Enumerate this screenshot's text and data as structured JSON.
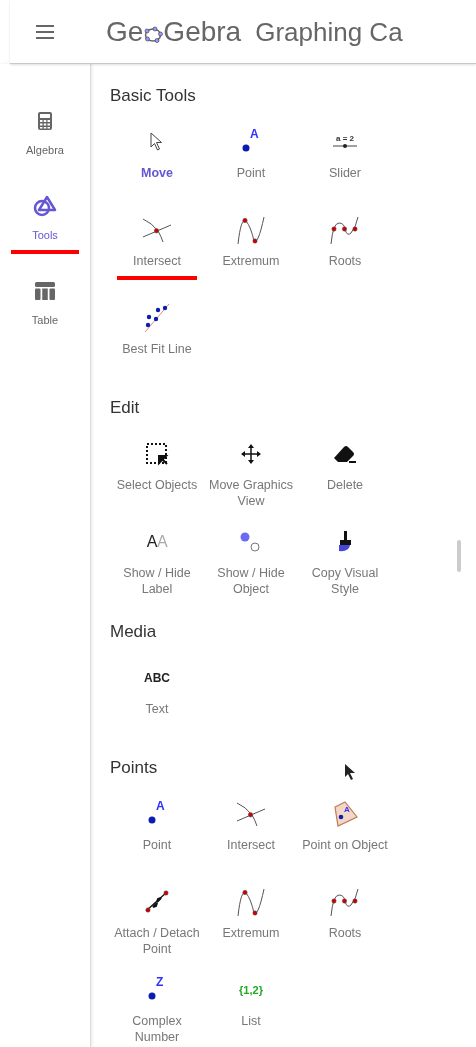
{
  "header": {
    "logo_before": "Ge",
    "logo_after": "Gebra",
    "title": "Graphing Ca"
  },
  "sidebar": {
    "items": [
      {
        "kind": "algebra",
        "label": "Algebra",
        "selected": false,
        "underlined": false
      },
      {
        "kind": "tools",
        "label": "Tools",
        "selected": true,
        "underlined": true
      },
      {
        "kind": "table",
        "label": "Table",
        "selected": false,
        "underlined": false
      }
    ]
  },
  "sections": [
    {
      "title": "Basic Tools",
      "tools": [
        {
          "kind": "move",
          "label": "Move",
          "selected": true,
          "underlined": false
        },
        {
          "kind": "point",
          "label": "Point",
          "glyph": "A",
          "selected": false,
          "underlined": false
        },
        {
          "kind": "slider",
          "label": "Slider",
          "glyph": "a = 2",
          "selected": false,
          "underlined": false
        },
        {
          "kind": "intersect",
          "label": "Intersect",
          "selected": false,
          "underlined": true
        },
        {
          "kind": "extremum",
          "label": "Extremum",
          "selected": false,
          "underlined": false
        },
        {
          "kind": "roots",
          "label": "Roots",
          "selected": false,
          "underlined": false
        },
        {
          "kind": "bestfit",
          "label": "Best Fit Line",
          "selected": false,
          "underlined": false
        }
      ]
    },
    {
      "title": "Edit",
      "tools": [
        {
          "kind": "select",
          "label": "Select Objects",
          "selected": false,
          "underlined": false
        },
        {
          "kind": "pan",
          "label": "Move Graphics View",
          "selected": false,
          "underlined": false
        },
        {
          "kind": "delete",
          "label": "Delete",
          "selected": false,
          "underlined": false
        },
        {
          "kind": "showlabel",
          "label": "Show / Hide Label",
          "glyph": "A",
          "glyph2": "A",
          "selected": false,
          "underlined": false
        },
        {
          "kind": "showobject",
          "label": "Show / Hide Object",
          "selected": false,
          "underlined": false
        },
        {
          "kind": "copystyle",
          "label": "Copy Visual Style",
          "selected": false,
          "underlined": false
        }
      ]
    },
    {
      "title": "Media",
      "tools": [
        {
          "kind": "text",
          "label": "Text",
          "glyph": "ABC",
          "selected": false,
          "underlined": false
        }
      ]
    },
    {
      "title": "Points",
      "tools": [
        {
          "kind": "point",
          "label": "Point",
          "glyph": "A",
          "selected": false,
          "underlined": false
        },
        {
          "kind": "intersect",
          "label": "Intersect",
          "selected": false,
          "underlined": false
        },
        {
          "kind": "pointonobject",
          "label": "Point on Object",
          "glyph": "A",
          "selected": false,
          "underlined": false
        },
        {
          "kind": "attach",
          "label": "Attach / Detach Point",
          "selected": false,
          "underlined": false
        },
        {
          "kind": "extremum",
          "label": "Extremum",
          "selected": false,
          "underlined": false
        },
        {
          "kind": "roots",
          "label": "Roots",
          "selected": false,
          "underlined": false
        },
        {
          "kind": "point",
          "label": "Complex Number",
          "glyph": "Z",
          "selected": false,
          "underlined": false
        },
        {
          "kind": "list",
          "label": "List",
          "glyph": "{1,2}",
          "selected": false,
          "underlined": false
        }
      ]
    }
  ]
}
